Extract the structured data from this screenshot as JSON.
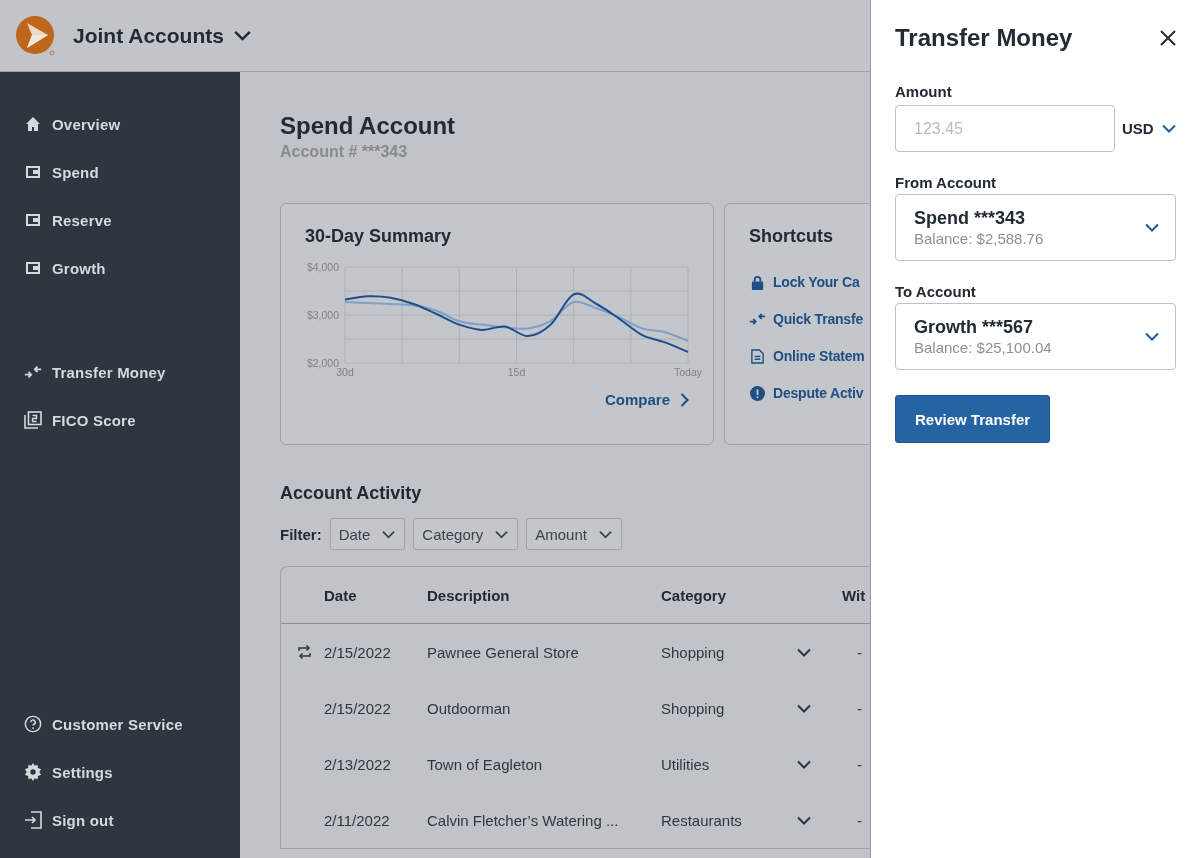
{
  "header": {
    "title": "Joint Accounts"
  },
  "sidebar": {
    "items": [
      {
        "label": "Overview",
        "selected": false
      },
      {
        "label": "Spend",
        "selected": false
      },
      {
        "label": "Reserve",
        "selected": false
      },
      {
        "label": "Growth",
        "selected": false
      }
    ],
    "actions": [
      {
        "label": "Transfer Money"
      },
      {
        "label": "FICO Score"
      }
    ],
    "footer": [
      {
        "label": "Customer Service"
      },
      {
        "label": "Settings"
      },
      {
        "label": "Sign out"
      }
    ]
  },
  "account": {
    "title": "Spend Account",
    "number": "Account # ***343"
  },
  "summary": {
    "title": "30-Day Summary",
    "link": "Compare",
    "chart_data": {
      "type": "line",
      "x": [
        30,
        28,
        26,
        24,
        22,
        20,
        18,
        16,
        14,
        12,
        10,
        8,
        6,
        4,
        2,
        0
      ],
      "xlim": [
        30,
        0
      ],
      "ylim": [
        2000,
        4000
      ],
      "xticks": [
        {
          "value": 30,
          "label": "30d"
        },
        {
          "value": 15,
          "label": "15d"
        },
        {
          "value": 0,
          "label": "Today"
        }
      ],
      "yticks": [
        {
          "value": 4000,
          "label": "$4,000"
        },
        {
          "value": 3000,
          "label": "$3,000"
        },
        {
          "value": 2000,
          "label": "$2,000"
        }
      ],
      "series": [
        {
          "color": "#1d4f8c",
          "values": [
            3320,
            3390,
            3360,
            3230,
            3020,
            2800,
            2690,
            2760,
            2560,
            2800,
            3430,
            3230,
            2920,
            2580,
            2430,
            2230
          ]
        },
        {
          "color": "#7f9fc6",
          "values": [
            3270,
            3250,
            3230,
            3200,
            3090,
            2870,
            2800,
            2740,
            2720,
            2880,
            3270,
            3140,
            2950,
            2720,
            2640,
            2460
          ]
        }
      ]
    }
  },
  "shortcuts": {
    "title": "Shortcuts",
    "items": [
      {
        "label": "Lock Your Ca"
      },
      {
        "label": "Quick Transfe"
      },
      {
        "label": "Online Statem"
      },
      {
        "label": "Despute Activ"
      }
    ]
  },
  "activity": {
    "title": "Account Activity",
    "filter_label": "Filter:",
    "filters": [
      "Date",
      "Category",
      "Amount"
    ],
    "columns": [
      "Date",
      "Description",
      "Category",
      "Wit"
    ],
    "rows": [
      {
        "recurring": true,
        "date": "2/15/2022",
        "description": "Pawnee General Store",
        "category": "Shopping",
        "withdrawal": "-"
      },
      {
        "recurring": false,
        "date": "2/15/2022",
        "description": "Outdoorman",
        "category": "Shopping",
        "withdrawal": "-"
      },
      {
        "recurring": false,
        "date": "2/13/2022",
        "description": "Town of Eagleton",
        "category": "Utilities",
        "withdrawal": "-"
      },
      {
        "recurring": false,
        "date": "2/11/2022",
        "description": "Calvin Fletcher’s Watering ...",
        "category": "Restaurants",
        "withdrawal": "-"
      }
    ]
  },
  "drawer": {
    "title": "Transfer Money",
    "amount_label": "Amount",
    "amount": {
      "placeholder": "123.45"
    },
    "currency": "USD",
    "from": {
      "label": "From Account",
      "account": "Spend ***343",
      "balance": "Balance: $2,588.76"
    },
    "to": {
      "label": "To Account",
      "account": "Growth ***567",
      "balance": "Balance: $25,100.04"
    },
    "button": "Review Transfer"
  }
}
